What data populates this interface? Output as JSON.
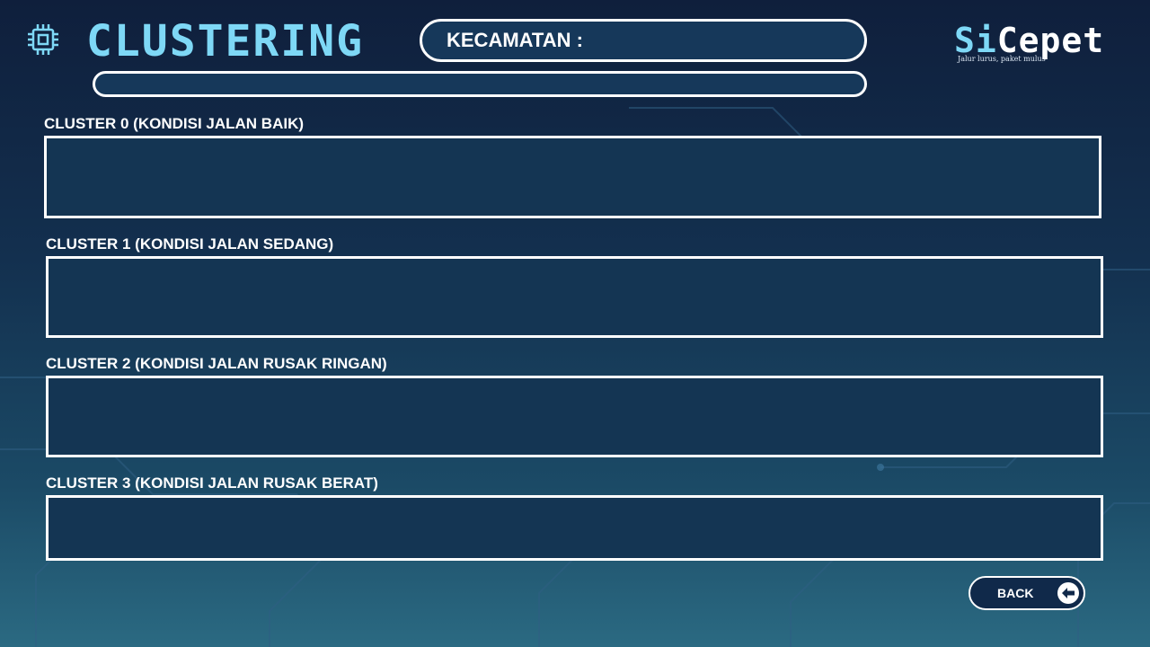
{
  "header": {
    "title": "CLUSTERING",
    "kecamatan_label": "KECAMATAN :",
    "kecamatan_value": ""
  },
  "logo": {
    "si": "Si",
    "cepet": "Cepet",
    "tagline": "Jalur lurus, paket mulus"
  },
  "clusters": [
    {
      "label": "CLUSTER 0 (KONDISI JALAN BAIK)",
      "content": ""
    },
    {
      "label": "CLUSTER 1 (KONDISI JALAN SEDANG)",
      "content": ""
    },
    {
      "label": "CLUSTER 2 (KONDISI JALAN RUSAK RINGAN)",
      "content": ""
    },
    {
      "label": "CLUSTER 3 (KONDISI JALAN RUSAK BERAT)",
      "content": ""
    }
  ],
  "back_button": {
    "label": "BACK",
    "icon": "arrow-left-circle-icon"
  },
  "colors": {
    "accent": "#7ed8f6",
    "panel": "#143553",
    "border": "#ffffff"
  }
}
